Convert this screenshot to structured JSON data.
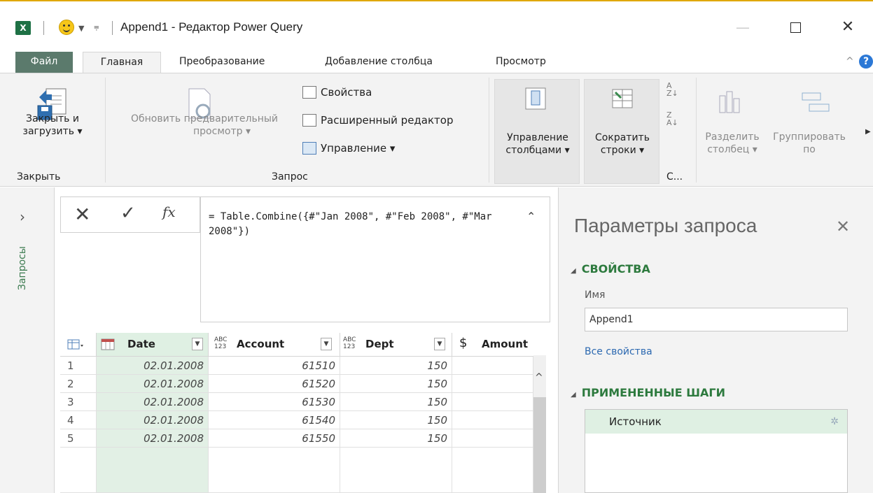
{
  "window": {
    "title": "Append1 - Редактор Power Query",
    "app_badge": "X"
  },
  "tabs": [
    "Файл",
    "Главная",
    "Преобразование",
    "Добавление столбца",
    "Просмотр"
  ],
  "ribbon": {
    "close_load_line1": "Закрыть и",
    "close_load_line2": "загрузить ▾",
    "group_close": "Закрыть",
    "refresh_line1": "Обновить предварительный",
    "refresh_line2": "просмотр ▾",
    "properties": "Свойства",
    "advanced_editor": "Расширенный редактор",
    "manage": "Управление ▾",
    "group_query": "Запрос",
    "manage_columns_line1": "Управление",
    "manage_columns_line2": "столбцами ▾",
    "reduce_rows_line1": "Сократить",
    "reduce_rows_line2": "строки ▾",
    "group_sort": "С...",
    "split_line1": "Разделить",
    "split_line2": "столбец ▾",
    "group_by_line1": "Группировать",
    "group_by_line2": "по"
  },
  "queries_pane": {
    "label": "Запросы"
  },
  "formula": {
    "text": "= Table.Combine({#\"Jan 2008\", #\"Feb 2008\", #\"Mar 2008\"})"
  },
  "grid": {
    "type_abc": "ABC",
    "type_123": "123",
    "currency_symbol": "$",
    "columns": [
      "Date",
      "Account",
      "Dept",
      "Amount"
    ],
    "rows": [
      {
        "num": "1",
        "date": "02.01.2008",
        "account": "61510",
        "dept": "150"
      },
      {
        "num": "2",
        "date": "02.01.2008",
        "account": "61520",
        "dept": "150"
      },
      {
        "num": "3",
        "date": "02.01.2008",
        "account": "61530",
        "dept": "150"
      },
      {
        "num": "4",
        "date": "02.01.2008",
        "account": "61540",
        "dept": "150"
      },
      {
        "num": "5",
        "date": "02.01.2008",
        "account": "61550",
        "dept": "150"
      }
    ]
  },
  "query_settings": {
    "title": "Параметры запроса",
    "properties_header": "СВОЙСТВА",
    "name_label": "Имя",
    "name_value": "Append1",
    "all_properties": "Все свойства",
    "applied_steps_header": "ПРИМЕНЕННЫЕ ШАГИ",
    "steps": [
      "Источник"
    ]
  },
  "colors": {
    "file_tab": "#5b7a6c",
    "accent_green": "#2d7a3e",
    "date_column_bg": "#e2f0e5",
    "link_blue": "#2b68b0"
  }
}
